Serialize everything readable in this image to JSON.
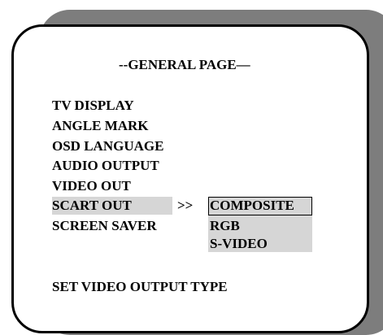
{
  "page": {
    "title": "--GENERAL PAGE—"
  },
  "menu": {
    "items": [
      {
        "label": "TV DISPLAY"
      },
      {
        "label": "ANGLE MARK"
      },
      {
        "label": "OSD LANGUAGE"
      },
      {
        "label": "AUDIO OUTPUT"
      },
      {
        "label": "VIDEO OUT"
      },
      {
        "label": "SCART OUT",
        "selected": true
      },
      {
        "label": "SCREEN SAVER"
      }
    ],
    "submenu_arrow": ">>"
  },
  "submenu": {
    "options": [
      {
        "label": "COMPOSITE",
        "selected": true
      },
      {
        "label": "RGB"
      },
      {
        "label": "S-VIDEO"
      }
    ]
  },
  "status": {
    "text": "SET VIDEO OUTPUT TYPE"
  },
  "colors": {
    "background": "#ffffff",
    "shadow": "#7d7d7d",
    "highlight": "#d6d6d6",
    "text": "#000000"
  }
}
